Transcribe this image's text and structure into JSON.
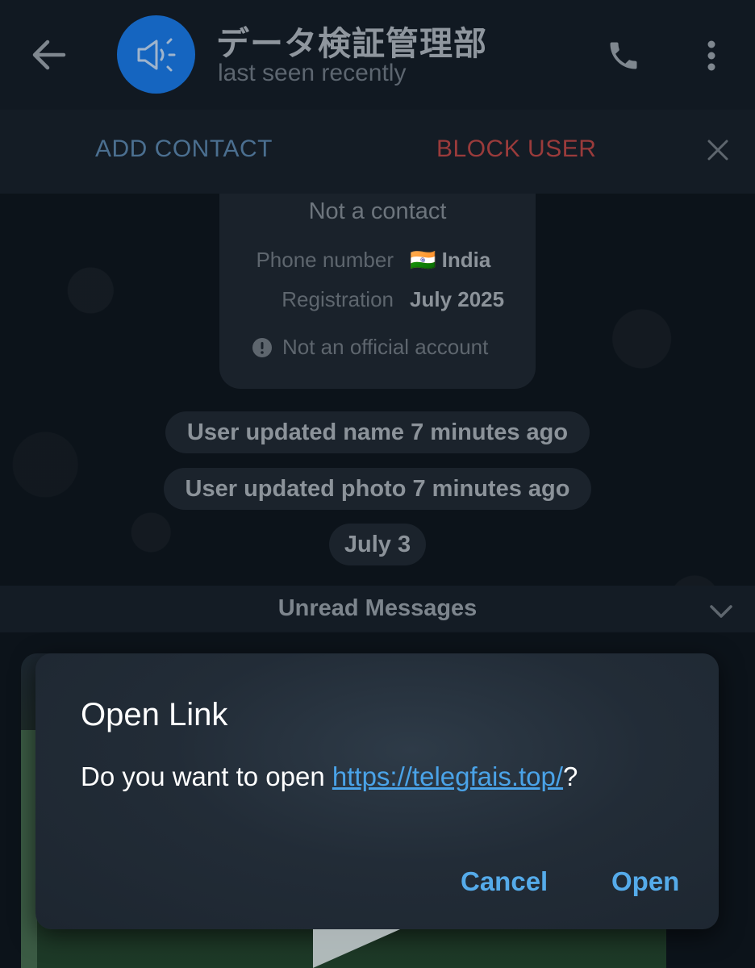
{
  "header": {
    "title": "データ検証管理部",
    "subtitle": "last seen recently"
  },
  "action_bar": {
    "add_contact": "ADD CONTACT",
    "block_user": "BLOCK USER"
  },
  "info_card": {
    "title": "Not a contact",
    "phone_label": "Phone number",
    "phone_flag": "🇮🇳",
    "phone_value": "India",
    "registration_label": "Registration",
    "registration_value": "July 2025",
    "notice": "Not an official account"
  },
  "service_messages": [
    "User updated name 7 minutes ago",
    "User updated photo 7 minutes ago"
  ],
  "date_pill": "July 3",
  "unread_label": "Unread Messages",
  "dialog": {
    "title": "Open Link",
    "body_prefix": "Do you want to open ",
    "link": "https://telegfais.top/",
    "body_suffix": "?",
    "cancel_label": "Cancel",
    "open_label": "Open"
  },
  "colors": {
    "accent_link": "#4aa3e8",
    "add_contact": "#4b6f90",
    "block_user": "#9a3b3b",
    "avatar": "#1565c0"
  },
  "icons": [
    "back-arrow-icon",
    "megaphone-icon",
    "phone-icon",
    "more-vert-icon",
    "close-icon",
    "info-icon",
    "chevron-down-icon"
  ]
}
